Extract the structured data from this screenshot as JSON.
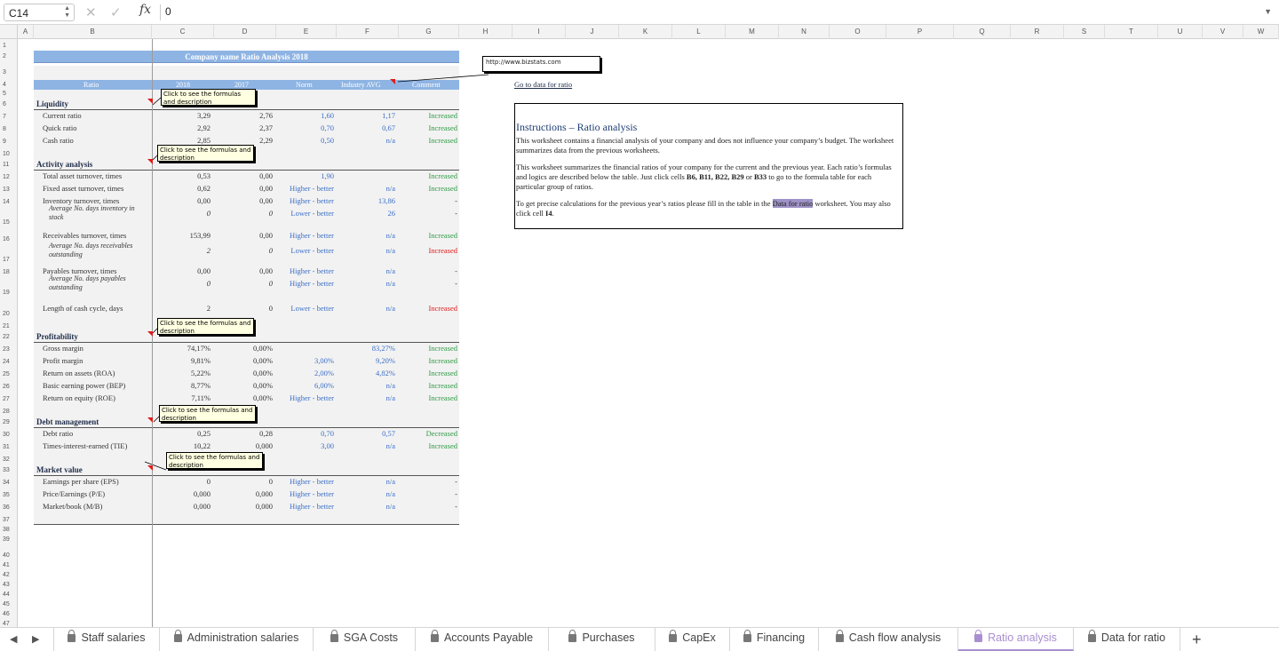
{
  "formula_bar": {
    "name_box": "C14",
    "formula": "0",
    "fx_label": "fx"
  },
  "columns": [
    "A",
    "B",
    "C",
    "D",
    "E",
    "F",
    "G",
    "H",
    "I",
    "J",
    "K",
    "L",
    "M",
    "N",
    "O",
    "P",
    "Q",
    "R",
    "S",
    "T",
    "U",
    "V",
    "W"
  ],
  "rows": [
    "1",
    "2",
    "3",
    "4",
    "5",
    "6",
    "7",
    "8",
    "9",
    "10",
    "11",
    "12",
    "13",
    "14",
    "15",
    "16",
    "17",
    "18",
    "19",
    "20",
    "21",
    "22",
    "23",
    "24",
    "25",
    "26",
    "27",
    "28",
    "29",
    "30",
    "31",
    "32",
    "33",
    "34",
    "35",
    "36",
    "37",
    "38",
    "39",
    "40",
    "41",
    "42",
    "43",
    "44",
    "45",
    "46",
    "47"
  ],
  "title": "Company name Ratio Analysis 2018",
  "headers": {
    "ratio": "Ratio",
    "y2018": "2018",
    "y2017": "2017",
    "norm": "Norm",
    "industry": "Industry AVG",
    "comment": "Comment"
  },
  "note_text": "Click to see the formulas and description",
  "sections": {
    "liquidity": "Liquidity",
    "activity": "Activity analysis",
    "profitability": "Profitability",
    "debt": "Debt management",
    "market": "Market value"
  },
  "data_rows": [
    {
      "label": "Current ratio",
      "y2018": "3,29",
      "y2017": "2,76",
      "norm": "1,60",
      "industry": "1,17",
      "comment": "Increased"
    },
    {
      "label": "Quick ratio",
      "y2018": "2,92",
      "y2017": "2,37",
      "norm": "0,70",
      "industry": "0,67",
      "comment": "Increased"
    },
    {
      "label": "Cash ratio",
      "y2018": "2,85",
      "y2017": "2,29",
      "norm": "0,50",
      "industry": "n/a",
      "comment": "Increased"
    },
    {
      "label": "Total asset turnover, times",
      "y2018": "0,53",
      "y2017": "0,00",
      "norm": "1,90",
      "industry": "",
      "comment": "Increased"
    },
    {
      "label": "Fixed asset turnover, times",
      "y2018": "0,62",
      "y2017": "0,00",
      "norm": "Higher - better",
      "industry": "n/a",
      "comment": "Increased"
    },
    {
      "label": "Inventory turnover, times",
      "y2018": "0,00",
      "y2017": "0,00",
      "norm": "Higher - better",
      "industry": "13,86",
      "comment": "-"
    },
    {
      "label": "Average No. days inventory in stock",
      "y2018": "0",
      "y2017": "0",
      "norm": "Lower - better",
      "industry": "26",
      "comment": "-"
    },
    {
      "label": "Receivables turnover, times",
      "y2018": "153,99",
      "y2017": "0,00",
      "norm": "Higher - better",
      "industry": "n/a",
      "comment": "Increased"
    },
    {
      "label": "Average No. days receivables outstanding",
      "y2018": "2",
      "y2017": "0",
      "norm": "Lower - better",
      "industry": "n/a",
      "comment": "Increased"
    },
    {
      "label": "Payables turnover, times",
      "y2018": "0,00",
      "y2017": "0,00",
      "norm": "Higher - better",
      "industry": "n/a",
      "comment": "-"
    },
    {
      "label": "Average No. days payables outstanding",
      "y2018": "0",
      "y2017": "0",
      "norm": "Higher - better",
      "industry": "n/a",
      "comment": "-"
    },
    {
      "label": "Length of cash cycle, days",
      "y2018": "2",
      "y2017": "0",
      "norm": "Lower - better",
      "industry": "n/a",
      "comment": "Increased"
    },
    {
      "label": "Gross margin",
      "y2018": "74,17%",
      "y2017": "0,00%",
      "norm": "",
      "industry": "83,27%",
      "comment": "Increased"
    },
    {
      "label": "Profit margin",
      "y2018": "9,81%",
      "y2017": "0,00%",
      "norm": "3,00%",
      "industry": "9,20%",
      "comment": "Increased"
    },
    {
      "label": "Return on assets (ROA)",
      "y2018": "5,22%",
      "y2017": "0,00%",
      "norm": "2,00%",
      "industry": "4,82%",
      "comment": "Increased"
    },
    {
      "label": "Basic earning power (BEP)",
      "y2018": "8,77%",
      "y2017": "0,00%",
      "norm": "6,00%",
      "industry": "n/a",
      "comment": "Increased"
    },
    {
      "label": "Return on equity (ROE)",
      "y2018": "7,11%",
      "y2017": "0,00%",
      "norm": "Higher - better",
      "industry": "n/a",
      "comment": "Increased"
    },
    {
      "label": "Debt ratio",
      "y2018": "0,25",
      "y2017": "0,28",
      "norm": "0,70",
      "industry": "0,57",
      "comment": "Decreased"
    },
    {
      "label": "Times-interest-earned (TIE)",
      "y2018": "10,22",
      "y2017": "0,000",
      "norm": "3,00",
      "industry": "n/a",
      "comment": "Increased"
    },
    {
      "label": "Earnings per share (EPS)",
      "y2018": "0",
      "y2017": "0",
      "norm": "Higher - better",
      "industry": "n/a",
      "comment": "-"
    },
    {
      "label": "Price/Earnings (P/E)",
      "y2018": "0,000",
      "y2017": "0,000",
      "norm": "Higher - better",
      "industry": "n/a",
      "comment": "-"
    },
    {
      "label": "Market/book (M/B)",
      "y2018": "0,000",
      "y2017": "0,000",
      "norm": "Higher - better",
      "industry": "n/a",
      "comment": "-"
    }
  ],
  "link_box": "http://www.bizstats.com",
  "goto_link": "Go to data for ratio",
  "instructions": {
    "title": "Instructions – Ratio analysis",
    "p1": "This worksheet contains a financial analysis of your company and does not influence your company’s budget. The worksheet summarizes data from the previous worksheets.",
    "p2_a": "This worksheet summarizes the financial ratios of your company for the current and the previous year. Each ratio’s formulas and logics are described below the table. Just click cells ",
    "p2_cells": "B6, B11, B22, B29",
    "p2_b": " or ",
    "p2_cell2": "B33",
    "p2_c": " to go to the formula table for each particular group of ratios.",
    "p3_a": "To get precise calculations for the previous year’s ratios please fill in the table in the ",
    "p3_link": "Data for ratio",
    "p3_b": " worksheet. You may also click cell ",
    "p3_cell": "I4",
    "p3_c": "."
  },
  "tabs": [
    "Staff salaries",
    "Administration salaries",
    "SGA Costs",
    "Accounts Payable",
    "Purchases",
    "CapEx",
    "Financing",
    "Cash flow analysis",
    "Ratio analysis",
    "Data for ratio"
  ],
  "active_tab": "Ratio analysis",
  "colors": {
    "header_blue": "#8eb4e3",
    "green": "#2f9a44",
    "red": "#e01b1b",
    "blue": "#3b6fc7",
    "active_tab": "#a98fd1"
  }
}
